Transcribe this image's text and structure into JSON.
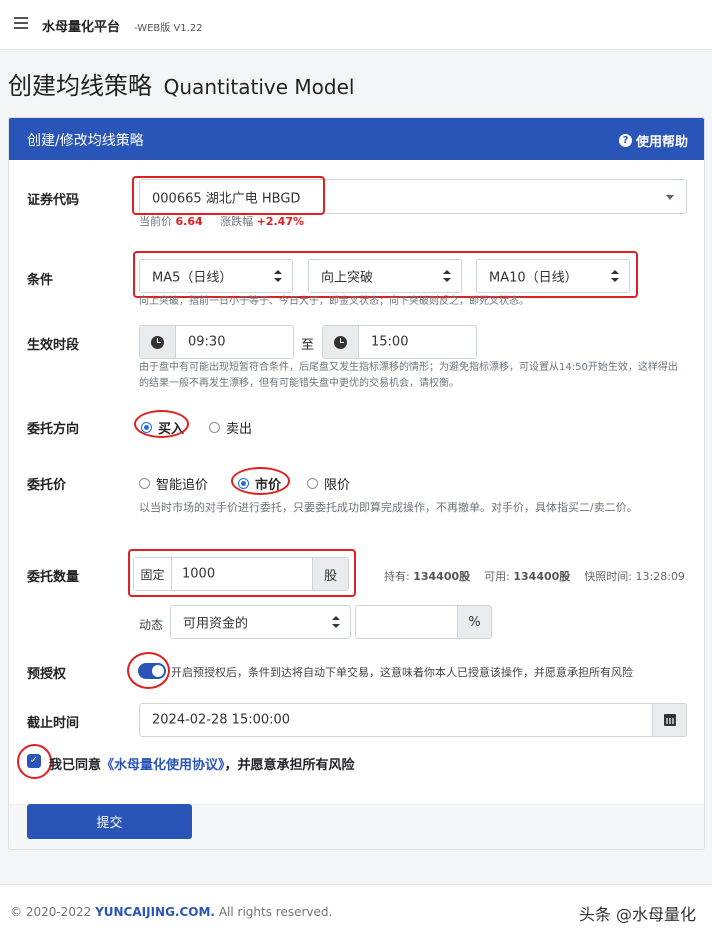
{
  "app": {
    "brand": "水母量化平台",
    "version": "-WEB版 V1.22"
  },
  "page": {
    "title": "创建均线策略",
    "title_en": "Quantitative Model"
  },
  "card": {
    "title": "创建/修改均线策略",
    "help": "使用帮助"
  },
  "stock": {
    "label": "证券代码",
    "value": "000665 湖北广电 HBGD",
    "price_label": "当前价",
    "price": "6.64",
    "change_label": "涨跌幅",
    "change": "+2.47%"
  },
  "condition": {
    "label": "条件",
    "ma_left": "MA5（日线）",
    "direction": "向上突破",
    "ma_right": "MA10（日线）",
    "hint": "向上突破，指前一日小于等于、今日大于，即金叉状态；向下突破则反之，即死叉状态。"
  },
  "period": {
    "label": "生效时段",
    "start": "09:30",
    "to": "至",
    "end": "15:00",
    "hint": "由于盘中有可能出现短暂符合条件，后尾盘又发生指标漂移的情形；为避免指标漂移，可设置从14:50开始生效，这样得出的结果一般不再发生漂移，但有可能错失盘中更优的交易机会，请权衡。"
  },
  "direction": {
    "label": "委托方向",
    "buy": "买入",
    "sell": "卖出"
  },
  "price_type": {
    "label": "委托价",
    "smart": "智能追价",
    "market": "市价",
    "limit": "限价",
    "hint": "以当时市场的对手价进行委托，只要委托成功即算完成操作，不再撤单。对手价，具体指买二/卖二价。"
  },
  "quantity": {
    "label": "委托数量",
    "fixed_label": "固定",
    "fixed_value": "1000",
    "unit": "股",
    "holding_label": "持有:",
    "holding": "134400股",
    "available_label": "可用:",
    "available": "134400股",
    "snapshot_label": "快照时间:",
    "snapshot": "13:28:09",
    "dynamic_label": "动态",
    "dynamic_select": "可用资金的",
    "percent_value": "",
    "percent_unit": "%"
  },
  "preauth": {
    "label": "预授权",
    "hint": "开启预授权后，条件到达将自动下单交易，这意味着你本人已授意该操作，并愿意承担所有风险"
  },
  "deadline": {
    "label": "截止时间",
    "value": "2024-02-28 15:00:00"
  },
  "agree": {
    "prefix": "我已同意",
    "link": "《水母量化使用协议》",
    "suffix": "，并愿意承担所有风险"
  },
  "submit": "提交",
  "footer": {
    "copy_prefix": "© 2020-2022",
    "site": "YUNCAIJING.COM.",
    "copy_suffix": "All rights reserved.",
    "watermark": "头条 @水母量化"
  }
}
